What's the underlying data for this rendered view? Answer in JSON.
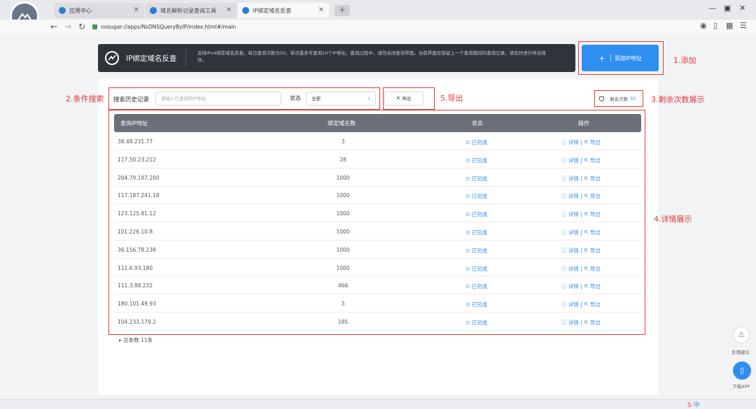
{
  "browser": {
    "tabs": [
      {
        "label": "应用中心"
      },
      {
        "label": "域名解析记录查询工具"
      },
      {
        "label": "IP绑定域名反查"
      }
    ],
    "url": "nosugar://apps/NsDNSQueryByIP/index.html#/main"
  },
  "banner": {
    "title": "IP绑定域名反查",
    "description": "支持IPv4绑定域名反查，每日查询次数为50，单次最多可查询10个IP地址。查询过程中，请勿关闭查询界面。当前界面仅保留上一个查询期间的查询记录，请及时进行导出保存。"
  },
  "add_button": {
    "label": "添加IP地址",
    "plus": "+"
  },
  "annotations": {
    "add": "1.添加",
    "filter": "2.条件搜索",
    "remain": "3.剩余次数展示",
    "details": "4.详情展示",
    "export": "5.导出"
  },
  "filter": {
    "search_label": "搜索历史记录",
    "search_placeholder": "请输入已查询的IP地址",
    "status_label": "状态",
    "status_value": "全部"
  },
  "export_button": {
    "label": "导出"
  },
  "remaining": {
    "label": "剩余次数",
    "value": "50"
  },
  "table": {
    "headers": [
      "查询IP地址",
      "绑定域名数",
      "状态",
      "操作"
    ],
    "rows": [
      {
        "ip": "38.48.231.77",
        "count": "3",
        "status": "已完成"
      },
      {
        "ip": "117.50.23.212",
        "count": "28",
        "status": "已完成"
      },
      {
        "ip": "204.79.197.200",
        "count": "1000",
        "status": "已完成"
      },
      {
        "ip": "117.187.241.18",
        "count": "1000",
        "status": "已完成"
      },
      {
        "ip": "123.125.81.12",
        "count": "1000",
        "status": "已完成"
      },
      {
        "ip": "101.226.10.8",
        "count": "1000",
        "status": "已完成"
      },
      {
        "ip": "36.156.78.238",
        "count": "1000",
        "status": "已完成"
      },
      {
        "ip": "111.6.93.180",
        "count": "1000",
        "status": "已完成"
      },
      {
        "ip": "111.3.88.232",
        "count": "466",
        "status": "已完成"
      },
      {
        "ip": "180.101.49.93",
        "count": "3",
        "status": "已完成"
      },
      {
        "ip": "104.233.179.2",
        "count": "185",
        "status": "已完成"
      }
    ],
    "action_detail": "详情",
    "action_export": "导出"
  },
  "footer": {
    "total": "总条数 11条"
  },
  "side": {
    "feedback": "反馈建议",
    "download": "下载APP"
  },
  "ime": {
    "label": "中"
  },
  "colors": {
    "accent": "#2f8ff0",
    "annotation": "#e53935",
    "banner": "#2f333a",
    "table_header": "#6a6f78"
  }
}
